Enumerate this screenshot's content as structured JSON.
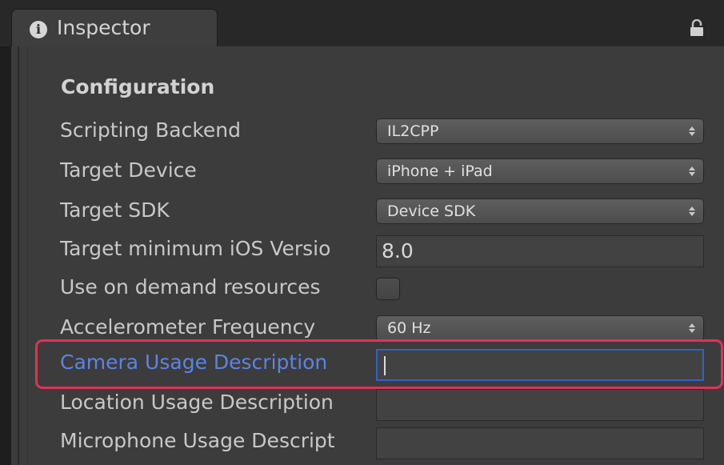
{
  "tab": {
    "title": "Inspector",
    "icon": "info-icon"
  },
  "lock": {
    "icon": "lock-icon"
  },
  "section": {
    "title": "Configuration"
  },
  "fields": [
    {
      "label": "Scripting Backend",
      "type": "dropdown",
      "value": "IL2CPP"
    },
    {
      "label": "Target Device",
      "type": "dropdown",
      "value": "iPhone + iPad"
    },
    {
      "label": "Target SDK",
      "type": "dropdown",
      "value": "Device SDK"
    },
    {
      "label": "Target minimum iOS Versio",
      "type": "text",
      "value": "8.0"
    },
    {
      "label": "Use on demand resources",
      "type": "checkbox",
      "checked": false
    },
    {
      "label": "Accelerometer Frequency",
      "type": "dropdown",
      "value": "60 Hz"
    },
    {
      "label": "Camera Usage Description",
      "type": "text",
      "value": "",
      "focused": true
    },
    {
      "label": "Location Usage Description",
      "type": "text",
      "value": ""
    },
    {
      "label": "Microphone Usage Descript",
      "type": "text",
      "value": ""
    }
  ],
  "colors": {
    "active_label": "#5b84e4",
    "focus_border": "#3062c8",
    "highlight_box": "#e0315a"
  }
}
